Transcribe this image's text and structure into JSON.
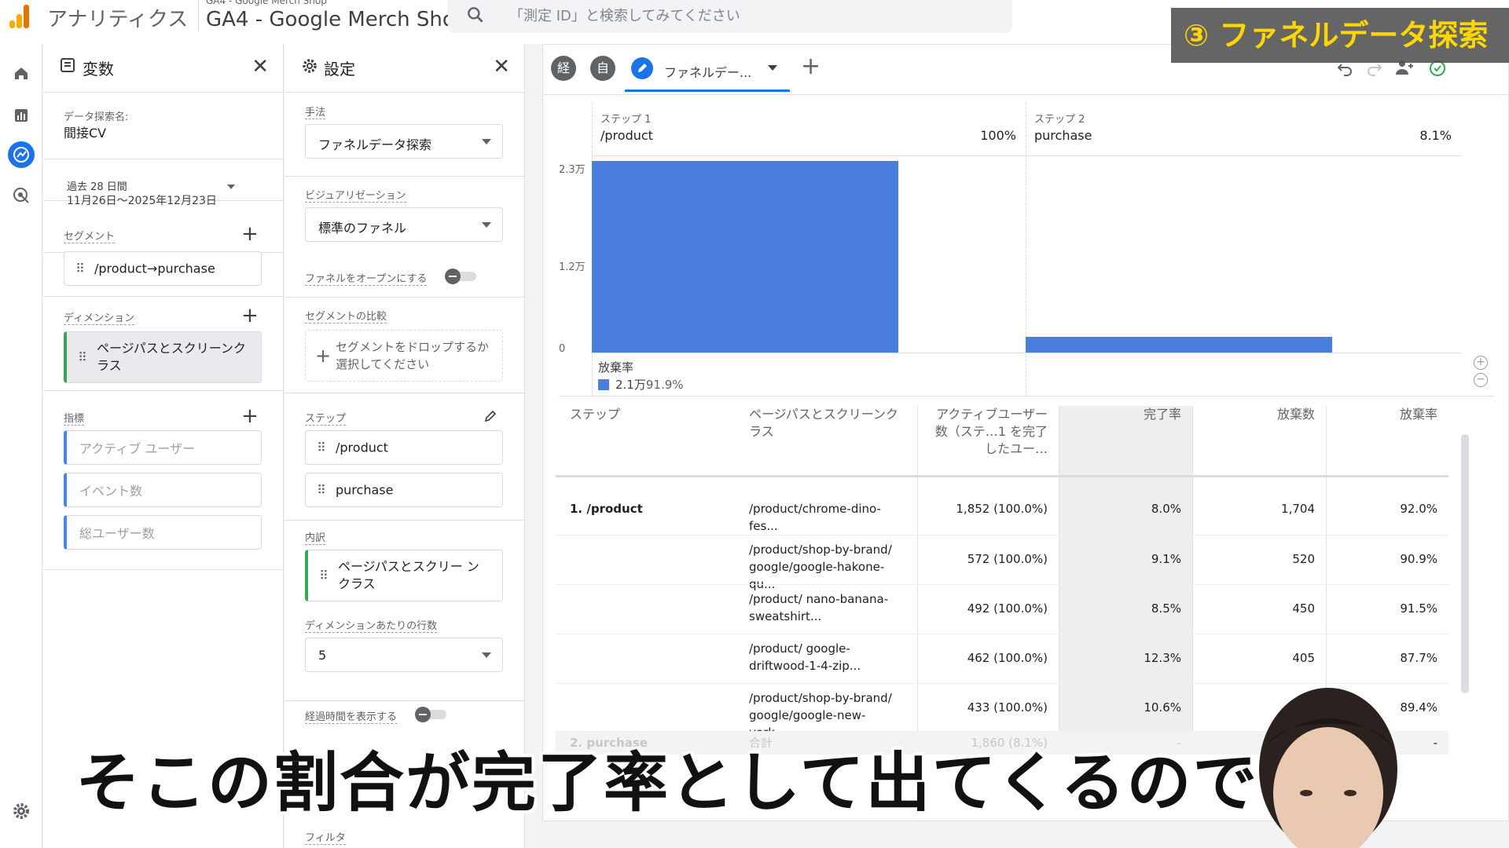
{
  "topbar": {
    "brand": "アナリティクス",
    "account_small": "GA4 - Google Merch Shop",
    "property": "GA4 - Google Merch Shop",
    "search_placeholder": "「測定 ID」と検索してみてください"
  },
  "banner": "③ ファネルデータ探索",
  "variables_panel": {
    "title": "変数",
    "exploration_name_label": "データ探索名:",
    "exploration_name": "間接CV",
    "date_range_label": "過去 28 日間",
    "date_range": "11月26日〜2025年12月23日",
    "segments_label": "セグメント",
    "segment": "/product→purchase",
    "dimensions_label": "ディメンション",
    "dimension": "ページパスとスクリーンクラス",
    "metrics_label": "指標",
    "metrics": [
      "アクティブ ユーザー",
      "イベント数",
      "総ユーザー数"
    ]
  },
  "settings_panel": {
    "title": "設定",
    "technique_label": "手法",
    "technique": "ファネルデータ探索",
    "visualization_label": "ビジュアリゼーション",
    "visualization": "標準のファネル",
    "open_funnel_label": "ファネルをオープンにする",
    "segment_compare_label": "セグメントの比較",
    "segment_drop_text": "セグメントをドロップするか選択してください",
    "steps_label": "ステップ",
    "steps": [
      "/product",
      "purchase"
    ],
    "breakdown_label": "内訳",
    "breakdown": "ページパスとスクリー ン クラス",
    "rows_per_dim_label": "ディメンションあたりの行数",
    "rows_per_dim": "5",
    "show_elapsed_label": "経過時間を表示する",
    "filter_label": "フィルタ"
  },
  "tabs": {
    "tab1_icon_label": "経",
    "tab2_icon_label": "自",
    "active_tab": "ファネルデー..."
  },
  "chart_data": {
    "type": "bar",
    "categories": [
      "/product",
      "purchase"
    ],
    "step_labels": [
      "ステップ 1",
      "ステップ 2"
    ],
    "step_percent": [
      "100%",
      "8.1%"
    ],
    "values": [
      23000,
      1860
    ],
    "ylim": [
      0,
      23000
    ],
    "y_ticks": [
      "2.3万",
      "1.2万",
      "0"
    ],
    "abandon_label": "放棄率",
    "abandon_value": "2.1万",
    "abandon_rate": "91.9%",
    "bar_color": "#4a7fe0"
  },
  "table": {
    "headers": [
      "ステップ",
      "ページパスとスクリーンクラス",
      "アクティブユーザー数（ステ…1 を完了したユー…",
      "完了率",
      "放棄数",
      "放棄率"
    ],
    "rows": [
      {
        "step": "1. /product",
        "path": "/product/chrome-dino-fes...",
        "users": "1,852 (100.0%)",
        "completion": "8.0%",
        "abandons": "1,704",
        "abandon_rate": "92.0%"
      },
      {
        "step": "",
        "path": "/product/shop-by-brand/ google/google-hakone-qu...",
        "users": "572 (100.0%)",
        "completion": "9.1%",
        "abandons": "520",
        "abandon_rate": "90.9%"
      },
      {
        "step": "",
        "path": "/product/ nano-banana-sweatshirt...",
        "users": "492 (100.0%)",
        "completion": "8.5%",
        "abandons": "450",
        "abandon_rate": "91.5%"
      },
      {
        "step": "",
        "path": "/product/ google-driftwood-1-4-zip...",
        "users": "462 (100.0%)",
        "completion": "12.3%",
        "abandons": "405",
        "abandon_rate": "87.7%"
      },
      {
        "step": "",
        "path": "/product/shop-by-brand/ google/google-new-york-...",
        "users": "433 (100.0%)",
        "completion": "10.6%",
        "abandons": "",
        "abandon_rate": "89.4%"
      },
      {
        "step": "2. purchase",
        "path": "合計",
        "users": "1,860 (8.1%)",
        "completion": "-",
        "abandons": "",
        "abandon_rate": "-"
      }
    ]
  },
  "subtitle": "そこの割合が完了率として出てくるので"
}
